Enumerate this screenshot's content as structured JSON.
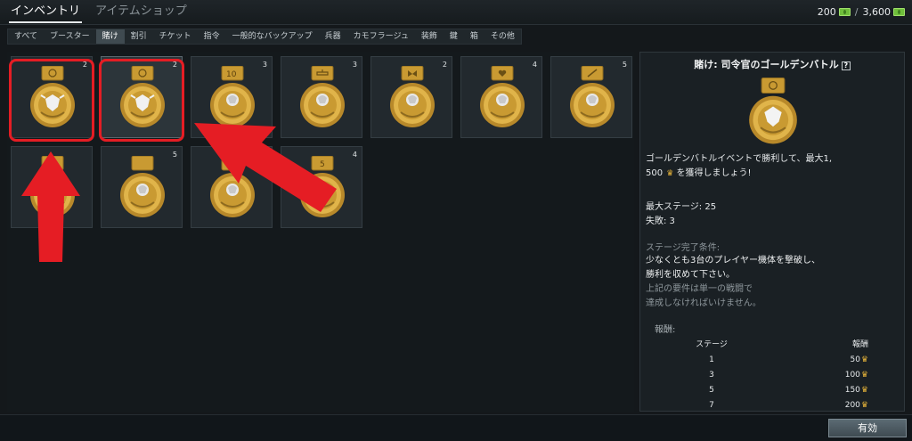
{
  "header": {
    "tabs": [
      {
        "label": "インベントリ",
        "active": true
      },
      {
        "label": "アイテムショップ",
        "active": false
      }
    ],
    "currency": {
      "silver": "200",
      "separator": "/",
      "gold": "3,600"
    }
  },
  "subtabs": [
    {
      "label": "すべて",
      "active": false
    },
    {
      "label": "ブースター",
      "active": false
    },
    {
      "label": "賭け",
      "active": true
    },
    {
      "label": "割引",
      "active": false
    },
    {
      "label": "チケット",
      "active": false
    },
    {
      "label": "指令",
      "active": false
    },
    {
      "label": "一般的なバックアップ",
      "active": false
    },
    {
      "label": "兵器",
      "active": false
    },
    {
      "label": "カモフラージュ",
      "active": false
    },
    {
      "label": "装飾",
      "active": false
    },
    {
      "label": "鍵",
      "active": false
    },
    {
      "label": "箱",
      "active": false
    },
    {
      "label": "その他",
      "active": false
    }
  ],
  "items": [
    {
      "qty": "2",
      "emblem": "eagle",
      "tab": "gear",
      "highlighted": true
    },
    {
      "qty": "2",
      "emblem": "eagle",
      "tab": "gear",
      "highlighted": true,
      "selected": true
    },
    {
      "qty": "3",
      "emblem": "lion",
      "tab": "10",
      "highlighted": false
    },
    {
      "qty": "3",
      "emblem": "lion",
      "tab": "tank",
      "highlighted": false
    },
    {
      "qty": "2",
      "emblem": "lion",
      "tab": "ribbon",
      "highlighted": false
    },
    {
      "qty": "4",
      "emblem": "lion",
      "tab": "heart",
      "highlighted": false
    },
    {
      "qty": "5",
      "emblem": "lion",
      "tab": "wrench",
      "highlighted": false
    },
    {
      "qty": "",
      "emblem": "lion",
      "tab": "plain",
      "highlighted": false
    },
    {
      "qty": "5",
      "emblem": "lion",
      "tab": "plain",
      "highlighted": false
    },
    {
      "qty": "",
      "emblem": "lion",
      "tab": "plain",
      "highlighted": false
    },
    {
      "qty": "4",
      "emblem": "lion",
      "tab": "5",
      "highlighted": false
    }
  ],
  "detail": {
    "title": "賭け: 司令官のゴールデンバトル",
    "help": "?",
    "description_line1": "ゴールデンバトルイベントで勝利して、最大1,",
    "description_line2_a": "500",
    "description_line2_b": "を獲得しましょう!",
    "max_stage": "最大ステージ: 25",
    "failures": "失敗: 3",
    "condition_label": "ステージ完了条件:",
    "condition_line1": "少なくとも3台のプレイヤー機体を撃破し、",
    "condition_line2": "勝利を収めて下さい。",
    "condition_line3": "上記の要件は単一の戦闘で",
    "condition_line4": "達成しなければいけません。",
    "reward_label": "報酬:",
    "reward_headers": {
      "stage": "ステージ",
      "reward": "報酬"
    },
    "rewards": [
      {
        "stage": "1",
        "reward": "50"
      },
      {
        "stage": "3",
        "reward": "100"
      },
      {
        "stage": "5",
        "reward": "150"
      },
      {
        "stage": "7",
        "reward": "200"
      }
    ]
  },
  "footer": {
    "apply_label": "有効"
  },
  "colors": {
    "highlight": "#e51d24",
    "medal_gold": "#d9a93a"
  }
}
